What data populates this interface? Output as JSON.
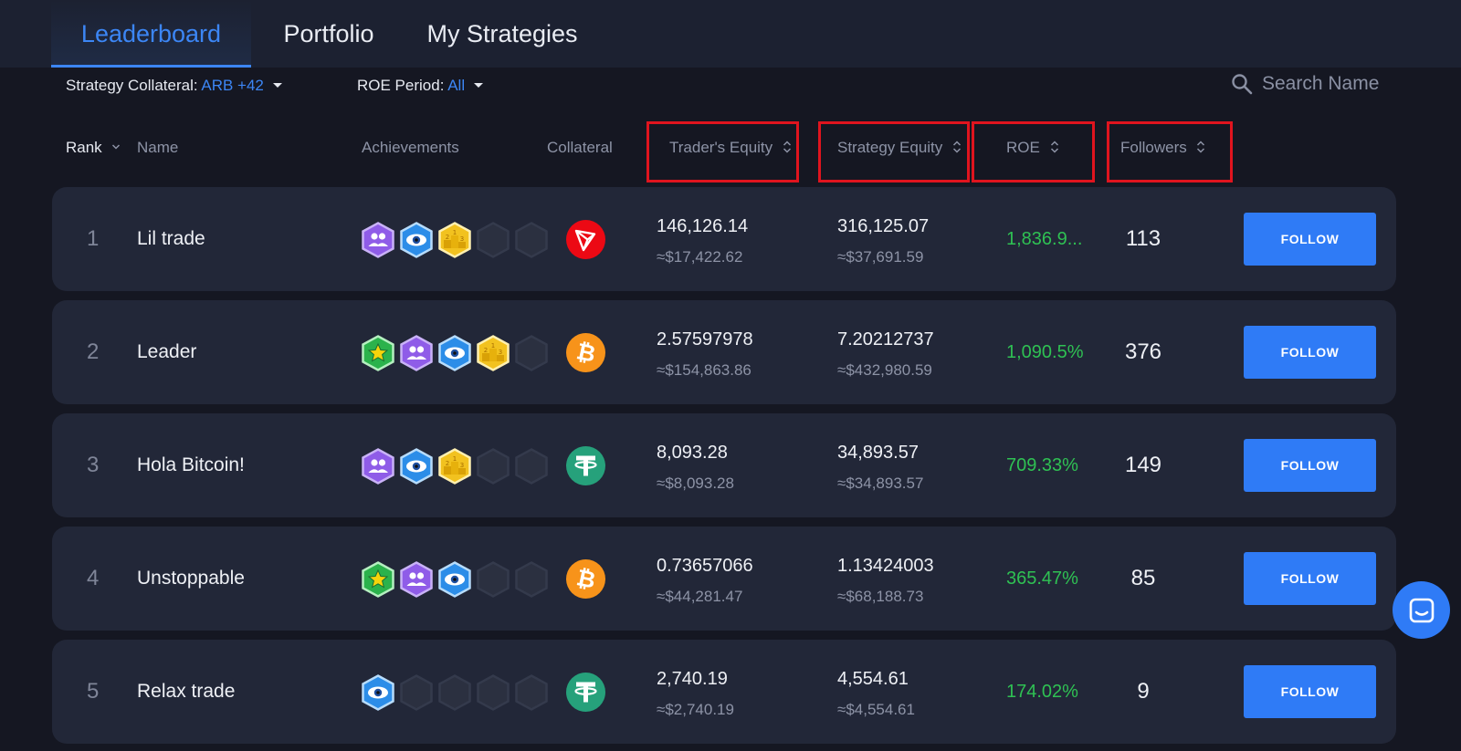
{
  "tabs": [
    {
      "label": "Leaderboard",
      "active": true
    },
    {
      "label": "Portfolio",
      "active": false
    },
    {
      "label": "My Strategies",
      "active": false
    }
  ],
  "filters": {
    "collateral_label": "Strategy Collateral: ",
    "collateral_value": "ARB +42",
    "period_label": "ROE Period: ",
    "period_value": "All"
  },
  "search": {
    "placeholder": "Search Name"
  },
  "columns": {
    "rank": "Rank",
    "name": "Name",
    "achievements": "Achievements",
    "collateral": "Collateral",
    "traders_equity": "Trader's Equity",
    "strategy_equity": "Strategy Equity",
    "roe": "ROE",
    "followers": "Followers"
  },
  "follow_label": "FOLLOW",
  "colors": {
    "accent": "#2f7bf6",
    "positive": "#2fc153",
    "highlight_box": "#e0141e"
  },
  "rows": [
    {
      "rank": "1",
      "name": "Lil trade",
      "badges": [
        "users-badge",
        "eye-badge",
        "podium-badge",
        "empty",
        "empty"
      ],
      "collateral_icon": "tron-icon",
      "traders_equity": "146,126.14",
      "traders_equity_usd": "≈$17,422.62",
      "strategy_equity": "316,125.07",
      "strategy_equity_usd": "≈$37,691.59",
      "roe": "1,836.9...",
      "followers": "113"
    },
    {
      "rank": "2",
      "name": "Leader",
      "badges": [
        "star-badge",
        "users-badge",
        "eye-badge",
        "podium-badge",
        "empty"
      ],
      "collateral_icon": "bitcoin-icon",
      "traders_equity": "2.57597978",
      "traders_equity_usd": "≈$154,863.86",
      "strategy_equity": "7.20212737",
      "strategy_equity_usd": "≈$432,980.59",
      "roe": "1,090.5%",
      "followers": "376"
    },
    {
      "rank": "3",
      "name": "Hola Bitcoin!",
      "badges": [
        "users-badge",
        "eye-badge",
        "podium-badge",
        "empty",
        "empty"
      ],
      "collateral_icon": "tether-icon",
      "traders_equity": "8,093.28",
      "traders_equity_usd": "≈$8,093.28",
      "strategy_equity": "34,893.57",
      "strategy_equity_usd": "≈$34,893.57",
      "roe": "709.33%",
      "followers": "149"
    },
    {
      "rank": "4",
      "name": "Unstoppable",
      "badges": [
        "star-badge",
        "users-badge",
        "eye-badge",
        "empty",
        "empty"
      ],
      "collateral_icon": "bitcoin-icon",
      "traders_equity": "0.73657066",
      "traders_equity_usd": "≈$44,281.47",
      "strategy_equity": "1.13424003",
      "strategy_equity_usd": "≈$68,188.73",
      "roe": "365.47%",
      "followers": "85"
    },
    {
      "rank": "5",
      "name": "Relax trade",
      "badges": [
        "eye-badge",
        "empty",
        "empty",
        "empty",
        "empty"
      ],
      "collateral_icon": "tether-icon",
      "traders_equity": "2,740.19",
      "traders_equity_usd": "≈$2,740.19",
      "strategy_equity": "4,554.61",
      "strategy_equity_usd": "≈$4,554.61",
      "roe": "174.02%",
      "followers": "9"
    }
  ]
}
